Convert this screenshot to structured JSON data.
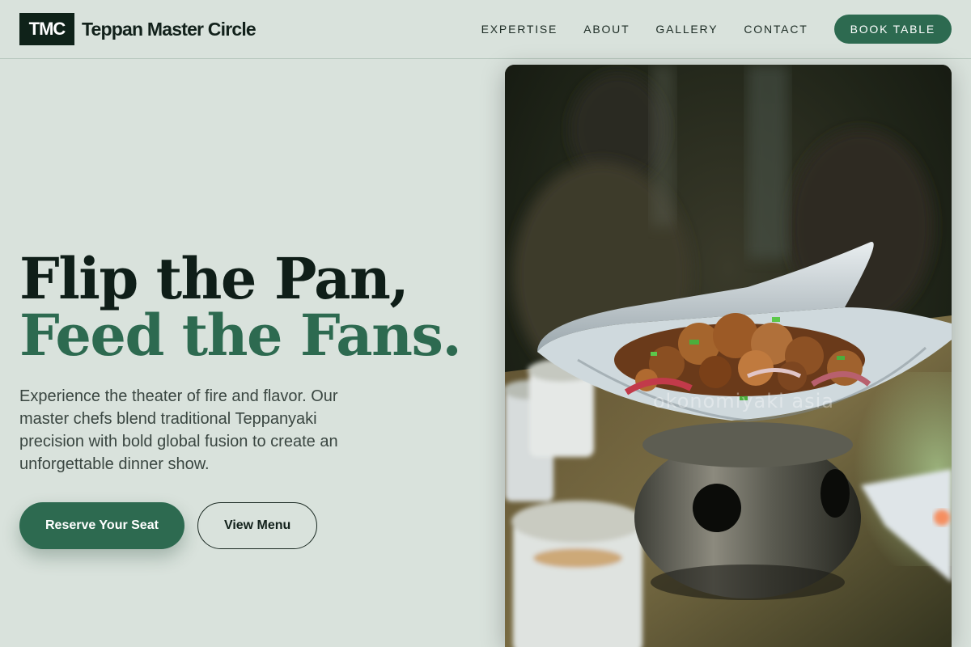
{
  "brand": {
    "logo_text": "TMC",
    "name": "Teppan Master Circle"
  },
  "nav": {
    "items": [
      "EXPERTISE",
      "ABOUT",
      "GALLERY",
      "CONTACT"
    ],
    "cta_label": "BOOK TABLE"
  },
  "hero": {
    "headline_line1": "Flip the Pan,",
    "headline_line2": "Feed the Fans.",
    "description": "Experience the theater of fire and flavor. Our master chefs blend traditional Teppanyaki precision with bold global fusion to create an unforgettable dinner show.",
    "primary_cta": "Reserve Your Seat",
    "secondary_cta": "View Menu"
  },
  "photo": {
    "watermark": "okonomiyaki asia"
  },
  "colors": {
    "background": "#d9e2dc",
    "accent": "#2d6a50",
    "logo_bg": "#0f2219",
    "text_dark": "#0f1e18"
  }
}
